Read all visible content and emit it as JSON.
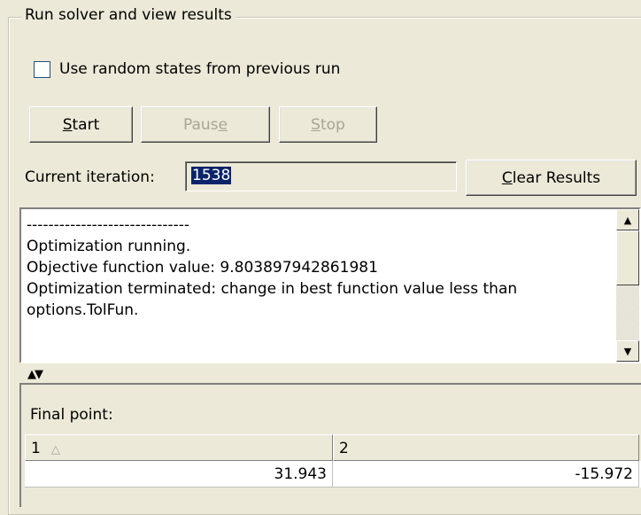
{
  "group": {
    "title": "Run solver and view results"
  },
  "checkbox": {
    "label": "Use random states from previous run",
    "checked": false
  },
  "buttons": {
    "start": {
      "mnemonic": "S",
      "rest": "tart"
    },
    "pause": {
      "pre": "Paus",
      "mnemonic": "e"
    },
    "stop": {
      "mnemonic": "S",
      "rest": "top"
    },
    "clear": {
      "mnemonic": "C",
      "rest": "lear Results"
    }
  },
  "iteration": {
    "label": "Current iteration:",
    "value": "1538"
  },
  "log": {
    "lines": [
      "------------------------------",
      "Optimization running.",
      "Objective function value: 9.803897942861981",
      "Optimization terminated: change in best function value less than",
      "options.TolFun."
    ]
  },
  "results": {
    "label": "Final point:",
    "columns": [
      "1",
      "2"
    ],
    "sort_indicator": "△",
    "rows": [
      [
        "31.943",
        "-15.972"
      ]
    ]
  }
}
